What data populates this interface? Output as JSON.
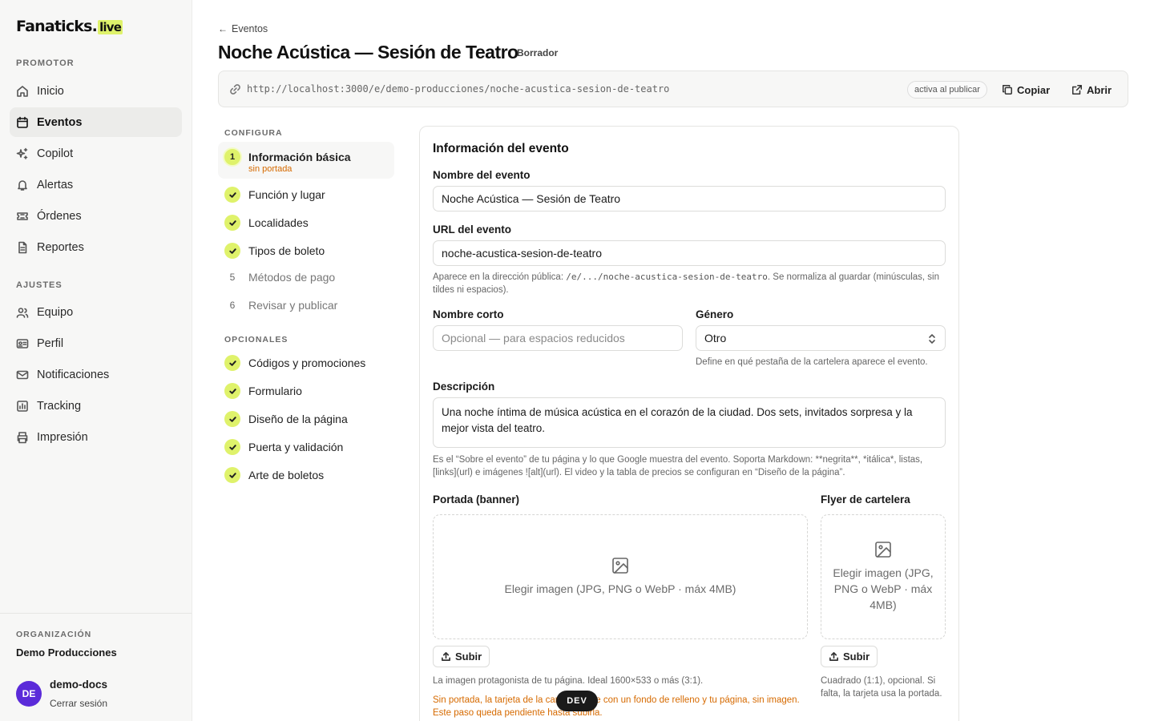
{
  "app": {
    "logo_main": "Fanaticks",
    "logo_suffix": "live"
  },
  "sidebar": {
    "section_promotor": "PROMOTOR",
    "promotor_items": [
      {
        "label": "Inicio",
        "icon": "home-icon"
      },
      {
        "label": "Eventos",
        "icon": "calendar-icon",
        "active": true
      },
      {
        "label": "Copilot",
        "icon": "sparkles-icon"
      },
      {
        "label": "Alertas",
        "icon": "bell-icon"
      },
      {
        "label": "Órdenes",
        "icon": "ticket-icon"
      },
      {
        "label": "Reportes",
        "icon": "file-icon"
      }
    ],
    "section_ajustes": "AJUSTES",
    "ajustes_items": [
      {
        "label": "Equipo",
        "icon": "users-icon"
      },
      {
        "label": "Perfil",
        "icon": "id-card-icon"
      },
      {
        "label": "Notificaciones",
        "icon": "mail-icon"
      },
      {
        "label": "Tracking",
        "icon": "chart-icon"
      },
      {
        "label": "Impresión",
        "icon": "printer-icon"
      }
    ],
    "org_label": "ORGANIZACIÓN",
    "org_name": "Demo Producciones",
    "user_initials": "DE",
    "user_name": "demo-docs",
    "logout": "Cerrar sesión"
  },
  "header": {
    "back": "Eventos",
    "title": "Noche Acústica — Sesión de Teatro",
    "status": "Borrador",
    "url": "http://localhost:3000/e/demo-producciones/noche-acustica-sesion-de-teatro",
    "url_pill": "activa al publicar",
    "copy_label": "Copiar",
    "open_label": "Abrir"
  },
  "steps": {
    "configure_label": "CONFIGURA",
    "current": {
      "num": "1",
      "label": "Información básica",
      "sub": "sin portada"
    },
    "items": [
      {
        "label": "Función y lugar",
        "done": true
      },
      {
        "label": "Localidades",
        "done": true
      },
      {
        "label": "Tipos de boleto",
        "done": true
      },
      {
        "label": "Métodos de pago",
        "num": "5"
      },
      {
        "label": "Revisar y publicar",
        "num": "6"
      }
    ],
    "optional_label": "OPCIONALES",
    "optional_items": [
      {
        "label": "Códigos y promociones"
      },
      {
        "label": "Formulario"
      },
      {
        "label": "Diseño de la página"
      },
      {
        "label": "Puerta y validación"
      },
      {
        "label": "Arte de boletos"
      }
    ]
  },
  "form": {
    "card_title": "Información del evento",
    "name_label": "Nombre del evento",
    "name_value": "Noche Acústica — Sesión de Teatro",
    "url_label": "URL del evento",
    "url_value": "noche-acustica-sesion-de-teatro",
    "url_help_pre": "Aparece en la dirección pública: ",
    "url_help_code": "/e/.../noche-acustica-sesion-de-teatro",
    "url_help_post": ". Se normaliza al guardar (minúsculas, sin tildes ni espacios).",
    "short_label": "Nombre corto",
    "short_placeholder": "Opcional — para espacios reducidos",
    "genre_label": "Género",
    "genre_value": "Otro",
    "genre_help": "Define en qué pestaña de la cartelera aparece el evento.",
    "desc_label": "Descripción",
    "desc_value": "Una noche íntima de música acústica en el corazón de la ciudad. Dos sets, invitados sorpresa y la mejor vista del teatro.",
    "desc_help": "Es el “Sobre el evento” de tu página y lo que Google muestra del evento. Soporta Markdown: **negrita**, *itálica*, listas, [links](url) e imágenes ![alt](url). El video y la tabla de precios se configuran en “Diseño de la página”.",
    "banner_label": "Portada (banner)",
    "banner_drop": "Elegir imagen (JPG, PNG o WebP · máx 4MB)",
    "banner_upload": "Subir",
    "banner_help": "La imagen protagonista de tu página. Ideal 1600×533 o más (3:1).",
    "banner_warn": "Sin portada, la tarjeta de la cartelera sale con un fondo de relleno y tu página, sin imagen. Este paso queda pendiente hasta subirla.",
    "flyer_label": "Flyer de cartelera",
    "flyer_drop": "Elegir imagen (JPG, PNG o WebP · máx 4MB)",
    "flyer_upload": "Subir",
    "flyer_help": "Cuadrado (1:1), opcional. Si falta, la tarjeta usa la portada."
  },
  "dev_badge": "DEV"
}
